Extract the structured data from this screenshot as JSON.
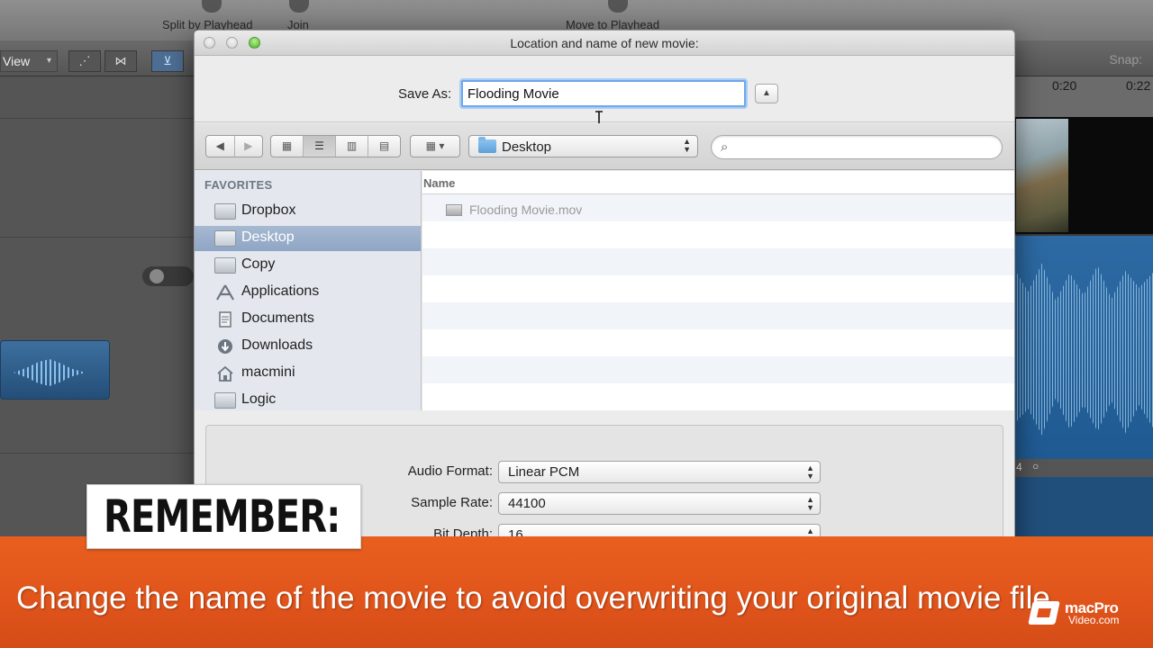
{
  "background_app": {
    "toolbar": {
      "split_label": "Split by Playhead",
      "join_label": "Join",
      "move_label": "Move to Playhead"
    },
    "view_menu": "View",
    "snap_label": "Snap:",
    "ruler": [
      "0:20",
      "0:22"
    ],
    "strip_marker": "4"
  },
  "dialog": {
    "title": "Location and name of new movie:",
    "save_as_label": "Save As:",
    "save_as_value": "Flooding Movie",
    "location": "Desktop",
    "search_placeholder": "",
    "sidebar": {
      "header": "FAVORITES",
      "items": [
        {
          "label": "Dropbox",
          "icon": "folder-icon"
        },
        {
          "label": "Desktop",
          "icon": "desktop-icon",
          "selected": true
        },
        {
          "label": "Copy",
          "icon": "folder-icon"
        },
        {
          "label": "Applications",
          "icon": "applications-icon"
        },
        {
          "label": "Documents",
          "icon": "documents-icon"
        },
        {
          "label": "Downloads",
          "icon": "downloads-icon"
        },
        {
          "label": "macmini",
          "icon": "home-icon"
        },
        {
          "label": "Logic",
          "icon": "folder-icon"
        }
      ]
    },
    "file_list": {
      "column_name": "Name",
      "files": [
        "Flooding Movie.mov"
      ]
    },
    "options": {
      "audio_format_label": "Audio Format:",
      "audio_format_value": "Linear PCM",
      "sample_rate_label": "Sample Rate:",
      "sample_rate_value": "44100",
      "bit_depth_label": "Bit Depth:",
      "bit_depth_value": "16"
    }
  },
  "overlay": {
    "remember": "REMEMBER:",
    "caption": "Change the name of the movie to avoid overwriting your original movie file.",
    "logo_line1": "macPro",
    "logo_line2": "Video.com",
    "banner_color": "#e0541b"
  }
}
